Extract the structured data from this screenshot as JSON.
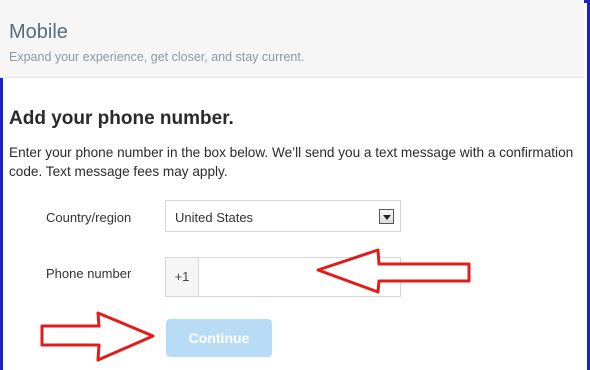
{
  "header": {
    "title": "Mobile",
    "subtitle": "Expand your experience, get closer, and stay current."
  },
  "section": {
    "title": "Add your phone number.",
    "description": "Enter your phone number in the box below. We’ll send you a text message with a confirmation code. Text message fees may apply."
  },
  "form": {
    "country_label": "Country/region",
    "country_value": "United States",
    "phone_label": "Phone number",
    "phone_prefix": "+1",
    "phone_value": "",
    "continue_label": "Continue"
  },
  "colors": {
    "frame_border": "#1a22c8",
    "annotation_arrow": "#e21b1b",
    "button_disabled": "#b8dcf6"
  }
}
